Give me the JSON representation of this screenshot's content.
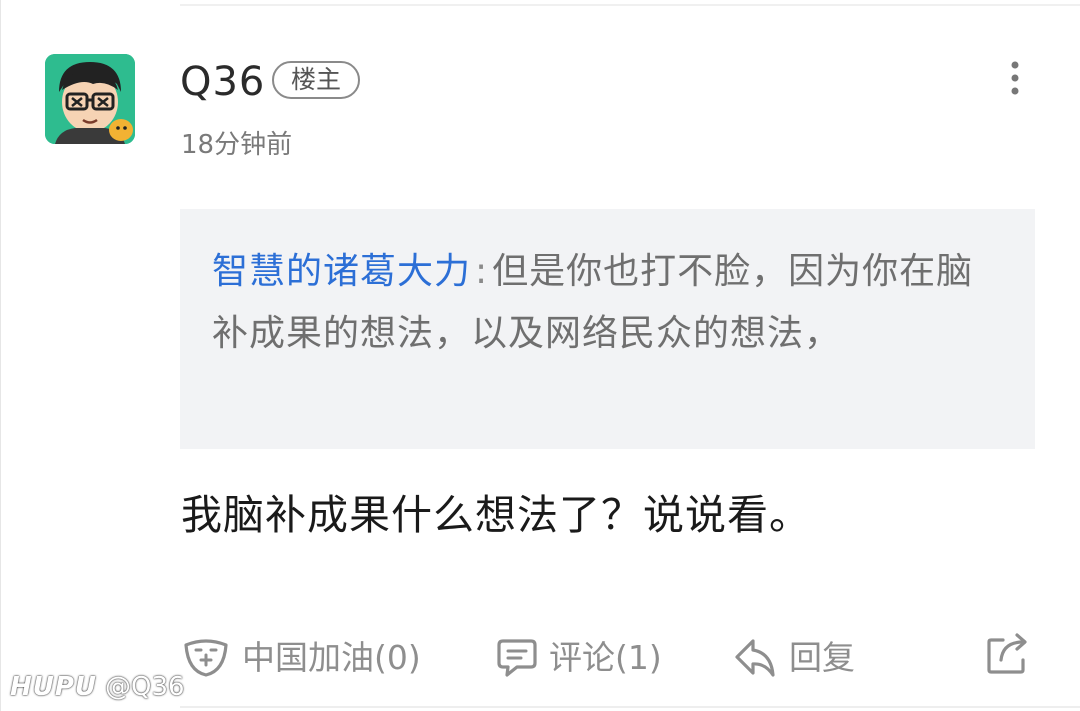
{
  "post": {
    "username": "Q36",
    "op_badge": "楼主",
    "timestamp": "18分钟前"
  },
  "quote": {
    "author": "智慧的诸葛大力",
    "separator": ":",
    "text": "但是你也打不脸，因为你在脑补成果的想法，以及网络民众的想法，"
  },
  "content": "我脑补成果什么想法了？说说看。",
  "actions": {
    "cheer_label": "中国加油(0)",
    "comment_label": "评论(1)",
    "reply_label": "回复"
  },
  "watermark": {
    "brand": "HUPU",
    "handle": "@Q36"
  },
  "icons": {
    "more": "more-vertical-icon",
    "cheer": "cheer-face-icon",
    "comment": "comment-bubble-icon",
    "reply": "reply-arrow-icon",
    "share": "share-icon"
  },
  "colors": {
    "quote_author": "#2c6fd6",
    "quote_background": "#f2f3f5",
    "avatar_background": "#2ebc8f"
  }
}
